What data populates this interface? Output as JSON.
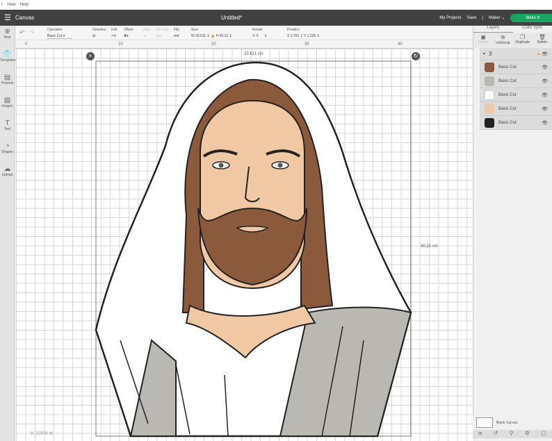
{
  "menu": [
    "t",
    "View",
    "Help"
  ],
  "header": {
    "title": "Canvas",
    "doc_title": "Untitled*",
    "my_projects": "My Projects",
    "save": "Save",
    "divider": "|",
    "machine": "Maker",
    "make_it": "Make It"
  },
  "toolbar": {
    "operation_label": "Operation",
    "operation_value": "Basic Cut",
    "deselect": "Deselect",
    "edit": "Edit",
    "offset": "Offset",
    "align": "Align",
    "arrange": "Arrange",
    "flip": "Flip",
    "size": "Size",
    "w_label": "W",
    "w_value": "33.611",
    "h_label": "H",
    "h_value": "40.22",
    "rotate": "Rotate",
    "rotate_value": "0",
    "position": "Position",
    "x_label": "X",
    "x_value": "3.761",
    "y_label": "Y",
    "y_value": "1.235"
  },
  "ruler": {
    "marks": [
      "0",
      "10",
      "20",
      "30",
      "40"
    ]
  },
  "sidebar": [
    {
      "label": "New",
      "icon": "plus"
    },
    {
      "label": "Templates",
      "icon": "shirt"
    },
    {
      "label": "Projects",
      "icon": "book"
    },
    {
      "label": "Images",
      "icon": "image"
    },
    {
      "label": "Text",
      "icon": "text"
    },
    {
      "label": "Shapes",
      "icon": "shapes"
    },
    {
      "label": "Upload",
      "icon": "upload"
    }
  ],
  "panel": {
    "tabs": [
      "Layers",
      "Color Sync"
    ],
    "actions": [
      "Group",
      "UnGroup",
      "Duplicate",
      "Delete"
    ],
    "group_name": "3",
    "layers": [
      {
        "name": "Basic Cut",
        "color": "#8b5a3c"
      },
      {
        "name": "Basic Cut",
        "color": "#b9b8b3"
      },
      {
        "name": "Basic Cut",
        "color": "#ffffff"
      },
      {
        "name": "Basic Cut",
        "color": "#f0c9a4"
      },
      {
        "name": "Basic Cut",
        "color": "#222222"
      }
    ],
    "blank_canvas": "Blank Canvas"
  },
  "canvas": {
    "width_label": "33.611 cm",
    "height_label": "40.22 cm",
    "zoom": "100%"
  },
  "colors": {
    "hair": "#8b5a3c",
    "skin": "#f0c9a4",
    "robe": "#b9b8b3",
    "accent": "#1aa563"
  }
}
